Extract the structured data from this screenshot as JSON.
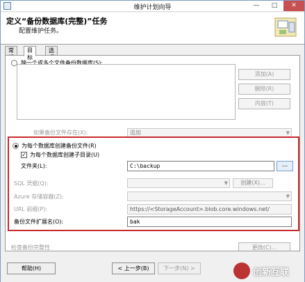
{
  "window": {
    "title": "维护计划向导"
  },
  "header": {
    "title": "定义“备份数据库(完整)”任务",
    "subtitle": "配置维护任务。"
  },
  "tabs": [
    {
      "label": "常规"
    },
    {
      "label": "目标"
    },
    {
      "label": "选项"
    }
  ],
  "targets": {
    "across_files_label": "跨一个或多个文件备份数据库(S):",
    "side_buttons": {
      "add": "添加(A)",
      "remove": "删除(R)",
      "contents": "内容(T)"
    },
    "if_exists_label": "如果备份文件存在(X):",
    "if_exists_value": "追加",
    "per_db_label": "为每个数据库创建备份文件(R)",
    "subdir_label": "为每个数据库创建子目录(U)",
    "folder_label": "文件夹(L):",
    "folder_value": "C:\\backup",
    "browse_label": "...",
    "sql_credential_label": "SQL 凭据(Q):",
    "create_label": "创建(X)...",
    "azure_container_label": "Azure 存储容器(Z):",
    "url_prefix_label": "URL 前缀(P):",
    "url_prefix_value": "https://<StorageAccount>.blob.core.windows.net/",
    "extension_label": "备份文件扩展名(O):",
    "extension_value": "bak",
    "lower_partial_label": "检查备份完整性",
    "lower_partial_button": "更改(C)..."
  },
  "footer": {
    "help": "帮助(H)",
    "back": "< 上一步(B)",
    "next": "下一步(N) >"
  },
  "watermark": {
    "text": "创新互联"
  }
}
